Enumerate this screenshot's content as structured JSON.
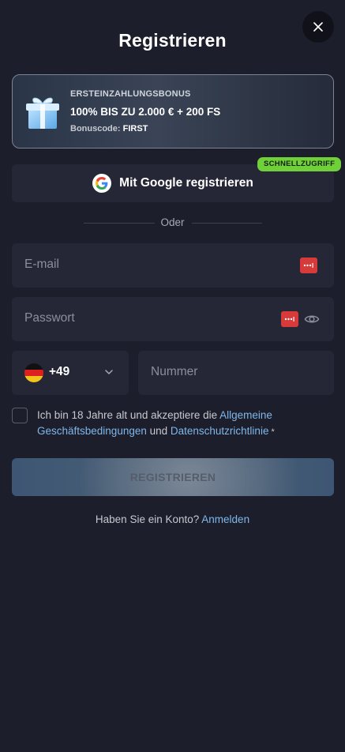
{
  "header": {
    "title": "Registrieren",
    "close_icon": "close-icon"
  },
  "bonus": {
    "eyebrow": "ERSTEINZAHLUNGSBONUS",
    "headline": "100% BIS ZU 2.000 € + 200 FS",
    "code_label": "Bonuscode:",
    "code_value": "FIRST",
    "icon": "gift-icon"
  },
  "google": {
    "label": "Mit Google registrieren",
    "badge": "SCHNELLZUGRIFF",
    "icon": "google-icon"
  },
  "divider": {
    "label": "Oder"
  },
  "form": {
    "email": {
      "placeholder": "E-mail",
      "value": ""
    },
    "password": {
      "placeholder": "Passwort",
      "value": ""
    },
    "phone": {
      "country_flag": "germany-flag-icon",
      "code": "+49",
      "placeholder": "Nummer",
      "value": ""
    },
    "terms": {
      "checked": false,
      "text_before": "Ich bin 18 Jahre alt und akzeptiere die ",
      "link_terms": "Allgemeine Geschäftsbedingungen",
      "text_middle": " und ",
      "link_privacy": "Datenschutzrichtlinie",
      "required_mark": " *"
    },
    "submit_label": "REGISTRIEREN"
  },
  "footer": {
    "question": "Haben Sie ein Konto?",
    "login_link": "Anmelden"
  },
  "colors": {
    "background": "#1d1e2b",
    "field": "#262736",
    "link": "#7fb7ea",
    "badge": "#6fd03a",
    "password_manager": "#d83a3a"
  }
}
